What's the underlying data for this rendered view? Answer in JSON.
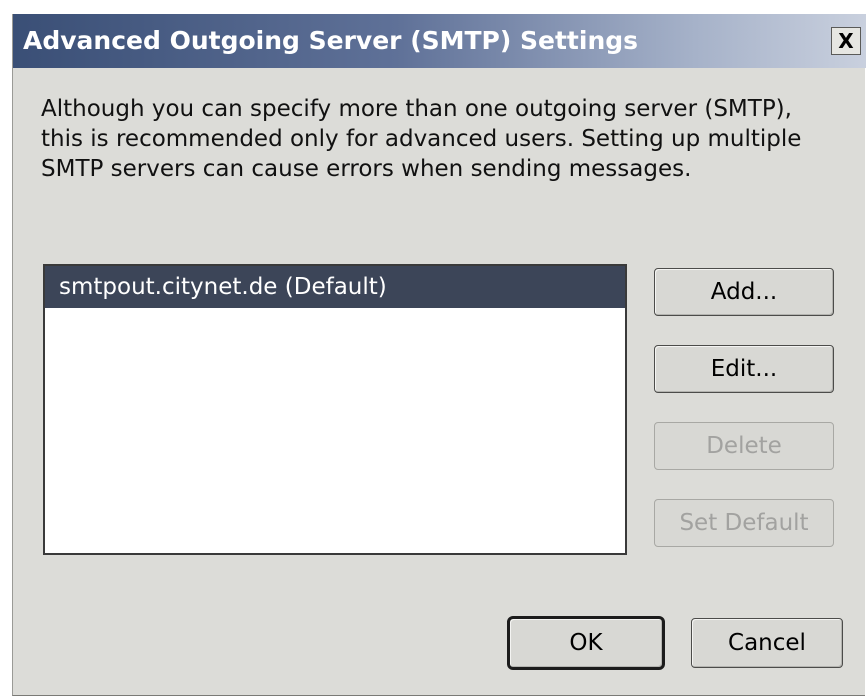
{
  "dialog": {
    "title": "Advanced Outgoing Server (SMTP) Settings",
    "close_label": "X",
    "description": "Although you can specify more than one outgoing server (SMTP), this is recommended only for advanced users. Setting up multiple SMTP servers can cause errors when sending messages."
  },
  "server_list": {
    "items": [
      {
        "label": "smtpout.citynet.de (Default)",
        "selected": true
      }
    ]
  },
  "buttons": {
    "add": "Add...",
    "edit": "Edit...",
    "delete": "Delete",
    "set_default": "Set Default",
    "ok": "OK",
    "cancel": "Cancel"
  },
  "states": {
    "delete_enabled": false,
    "set_default_enabled": false
  },
  "colors": {
    "titlebar_start": "#3a4f76",
    "titlebar_end": "#c9d0de",
    "selection": "#3c4558",
    "dialog_background": "#dcdcd8",
    "disabled_text": "#a2a2a0"
  }
}
